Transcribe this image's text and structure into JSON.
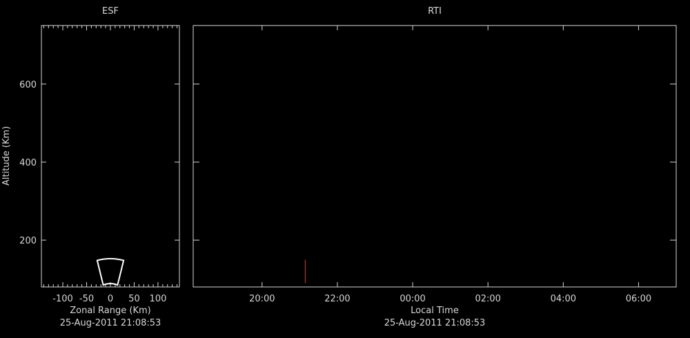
{
  "colors": {
    "background": "#000000",
    "axis": "#d8d8d8",
    "beam": "#ffffff",
    "rti_mark": "#b22222"
  },
  "chart_data": [
    {
      "type": "scatter",
      "title": "ESF",
      "xlabel": "Zonal Range (Km)",
      "ylabel": "Altitude (Km)",
      "timestamp": "25-Aug-2011 21:08:53",
      "xlim": [
        -145,
        145
      ],
      "ylim": [
        80,
        750
      ],
      "xticks": [
        -100,
        -50,
        0,
        50,
        100
      ],
      "xtick_labels": [
        "-100",
        "-50",
        "0",
        "50",
        "100"
      ],
      "yticks": [
        200,
        400,
        600
      ],
      "ytick_labels": [
        "200",
        "400",
        "600"
      ],
      "beam_outline": {
        "range_km": [
          90,
          150
        ],
        "half_angle_deg": 10,
        "description_points": [
          [
            -17,
            85
          ],
          [
            17,
            85
          ],
          [
            27,
            148
          ],
          [
            -27,
            148
          ]
        ]
      },
      "grid": false
    },
    {
      "type": "heatmap",
      "title": "RTI",
      "xlabel": "Local Time",
      "timestamp": "25-Aug-2011 21:08:53",
      "xlim_hours": [
        18.17,
        31.0
      ],
      "ylim": [
        80,
        750
      ],
      "xticks_hours": [
        20,
        22,
        24,
        26,
        28,
        30
      ],
      "xtick_labels": [
        "20:00",
        "22:00",
        "00:00",
        "02:00",
        "04:00",
        "06:00"
      ],
      "yticks": [
        200,
        400,
        600
      ],
      "data": [
        {
          "time": "21:08:53",
          "altitude_range": [
            90,
            150
          ]
        }
      ],
      "grid": false
    }
  ]
}
